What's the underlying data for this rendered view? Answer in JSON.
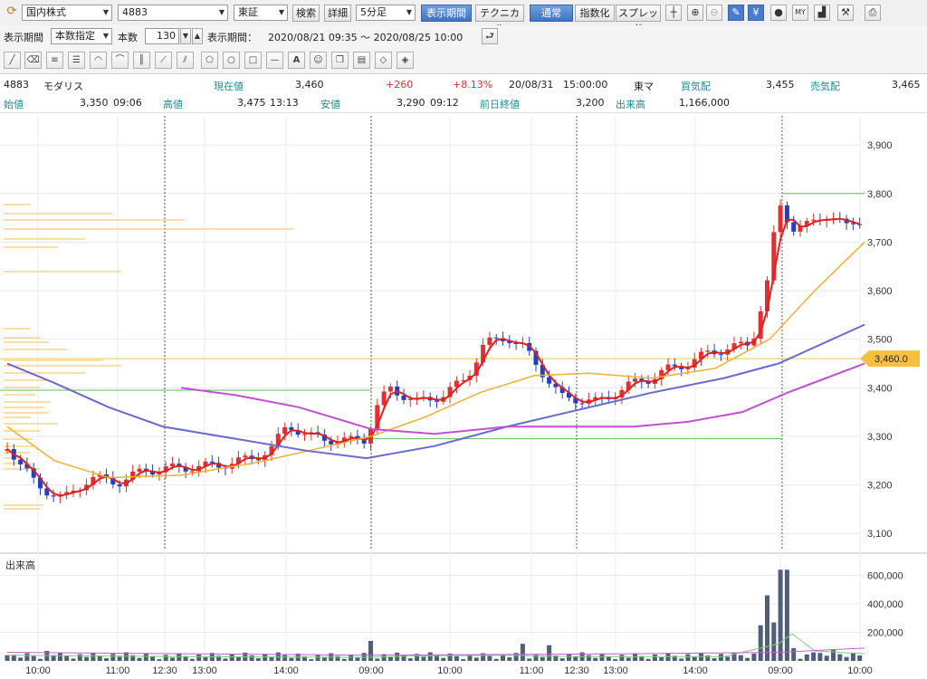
{
  "toolbar": {
    "market_select": "国内株式",
    "code_input": "4883",
    "exchange_select": "東証",
    "search_label": "検索",
    "detail_label": "詳細",
    "interval_select": "5分足",
    "display_period_label": "表示期間",
    "technical_label": "テクニカル",
    "normal_label": "通常",
    "index_label": "指数化",
    "spread_label": "スプレッド"
  },
  "period_bar": {
    "period_label": "表示期間",
    "mode_select": "本数指定",
    "count_label": "本数",
    "count_value": "130",
    "range_label": "表示期間：",
    "range_value": "2020/08/21 09:35 ～ 2020/08/25 10:00"
  },
  "quote": {
    "code": "4883",
    "name": "モダリス",
    "current_label": "現在値",
    "current_value": "3,460",
    "change": "+260",
    "change_pct": "+8.13%",
    "datetime": "20/08/31",
    "time": "15:00:00",
    "market": "東マ",
    "bid_label": "買気配",
    "bid_value": "3,455",
    "ask_label": "売気配",
    "ask_value": "3,465",
    "open_label": "始値",
    "open_value": "3,350",
    "open_time": "09:06",
    "high_label": "高値",
    "high_value": "3,475",
    "high_time": "13:13",
    "low_label": "安値",
    "low_value": "3,290",
    "low_time": "09:12",
    "prev_label": "前日終値",
    "prev_value": "3,200",
    "volume_label": "出来高",
    "volume_value": "1,166,000"
  },
  "chart_data": {
    "type": "candlestick",
    "price_axis": {
      "ticks": [
        "3,900",
        "3,800",
        "3,700",
        "3,600",
        "3,500",
        "3,400",
        "3,300",
        "3,200",
        "3,100"
      ],
      "range": [
        3065,
        3960
      ]
    },
    "current_price_label": "3,460.0",
    "volume_label": "出来高",
    "volume_axis": {
      "ticks": [
        "600,000",
        "400,000",
        "200,000"
      ],
      "range": [
        0,
        680000
      ]
    },
    "x_ticks": [
      "10:00",
      "11:00",
      "12:30",
      "13:00",
      "14:00",
      "09:00",
      "10:00",
      "11:00",
      "12:30",
      "13:00",
      "14:00",
      "09:00",
      "10:00"
    ],
    "colors": {
      "up": "#e03030",
      "down": "#1f3fc8",
      "ma_short": "#e02020",
      "ma_mid": "#f0b030",
      "ma_long": "#6a6ad0",
      "ma_longest": "#c050d0",
      "volume": "#4f5f7a"
    }
  }
}
